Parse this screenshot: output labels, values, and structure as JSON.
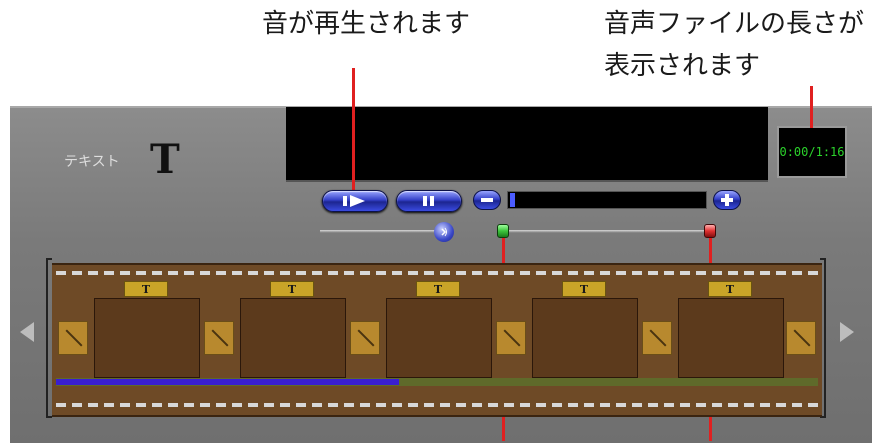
{
  "callouts": {
    "play_note": "音が再生されます",
    "length_note_line1": "音声ファイルの長さが",
    "length_note_line2": "表示されます"
  },
  "editor": {
    "text_label": "テキスト",
    "text_icon": "T",
    "time_display": "0:00/1:16"
  },
  "controls": {
    "play_icon": "play-icon",
    "pause_icon": "pause-icon",
    "zoom_out_icon": "minus-icon",
    "zoom_in_icon": "plus-icon"
  },
  "timeline": {
    "frame_tag": "T",
    "frame_count": 5,
    "audio_played_fraction": 0.45
  },
  "colors": {
    "leader": "#e02020",
    "time_text": "#2bd22b",
    "audio_progress": "#3a1fd0",
    "start_marker": "#3cc43c",
    "end_marker": "#e03030"
  }
}
